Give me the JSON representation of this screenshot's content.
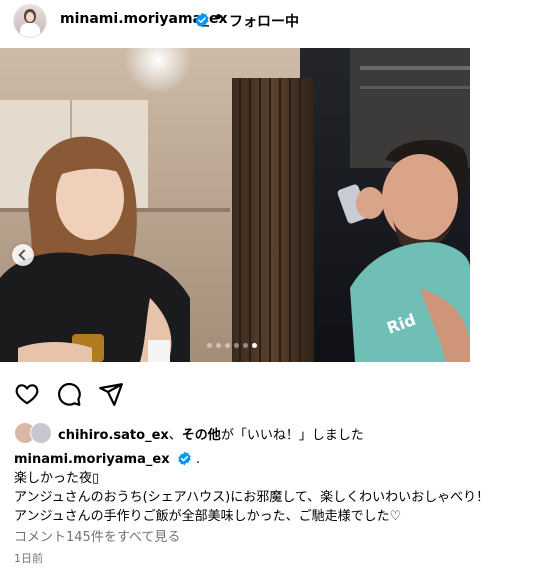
{
  "header": {
    "username": "minami.moriyama_ex",
    "separator": "•",
    "follow_status": "フォロー中"
  },
  "post": {
    "carousel": {
      "slide_count": 6,
      "active_slide_index": 5
    }
  },
  "icons": {
    "like": "heart-icon",
    "comment": "comment-icon",
    "share": "send-icon",
    "verified": "verified-badge-icon",
    "carousel_prev": "chevron-left-icon"
  },
  "likes": {
    "user": "chihiro.sato_ex",
    "separator": "、",
    "others": "その他",
    "suffix": "が「いいね！」しました"
  },
  "caption": {
    "username": "minami.moriyama_ex",
    "dot": ".",
    "lines": [
      "楽しかった夜▯",
      "アンジュさんのおうち(シェアハウス)にお邪魔して、楽しくわいわいおしゃべり！",
      "アンジュさんの手作りご飯が全部美味しかった、ご馳走様でした♡"
    ]
  },
  "comments_link": "コメント145件をすべて見る",
  "timestamp": "1日前",
  "colors": {
    "verified": "#0095f6",
    "secondary_text": "#737373",
    "text": "#000000"
  }
}
